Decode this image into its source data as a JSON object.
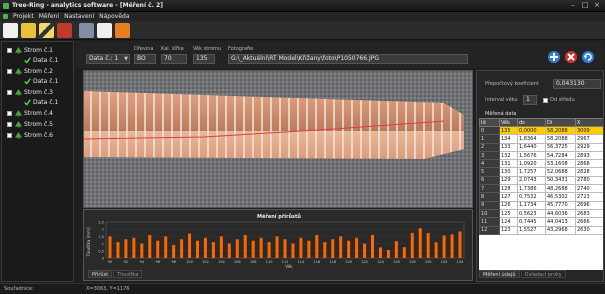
{
  "window": {
    "title": "Tree-Ring - analytics software - [Měření č. 2]"
  },
  "menu": {
    "items": [
      "Projekt",
      "Měření",
      "Nastavení",
      "Nápověda"
    ]
  },
  "tree": {
    "items": [
      {
        "label": "Strom č.1",
        "level": 0
      },
      {
        "label": "Data č.1",
        "level": 1
      },
      {
        "label": "Strom č.2",
        "level": 0
      },
      {
        "label": "Data č.1",
        "level": 1
      },
      {
        "label": "Strom č.3",
        "level": 0
      },
      {
        "label": "Data č.1",
        "level": 1
      },
      {
        "label": "Strom č.4",
        "level": 0
      },
      {
        "label": "Strom č.5",
        "level": 0
      },
      {
        "label": "Strom č.6",
        "level": 0
      }
    ]
  },
  "params": {
    "data_select": "Data č.: 1",
    "drevina_label": "Dřevina",
    "drevina_value": "BO",
    "kal_label": "Kal. šířka",
    "kal_value": "70",
    "vek_label": "Věk stromu",
    "vek_value": "135",
    "foto_label": "Fotografie",
    "foto_path": "G:\\_Aktuální\\RT Model\\Křižany\\foto\\P1050766.JPG"
  },
  "right": {
    "coef_label": "Přepočtový koeficient",
    "coef_value": "0,043130",
    "interval_label": "Interval věku",
    "interval_value": "1",
    "from_center_label": "Od středu",
    "section_title": "Měřená data",
    "columns": [
      "Id",
      "Věk",
      "ds",
      "Di",
      "X"
    ],
    "rows": [
      [
        "0",
        "135",
        "0,0000",
        "58,2088",
        "3009"
      ],
      [
        "1",
        "134",
        "1,8364",
        "58,2088",
        "2967"
      ],
      [
        "2",
        "133",
        "1,6440",
        "56,3725",
        "2929"
      ],
      [
        "3",
        "132",
        "1,5676",
        "54,7284",
        "2893"
      ],
      [
        "4",
        "131",
        "1,0920",
        "53,1608",
        "2868"
      ],
      [
        "5",
        "130",
        "1,7257",
        "52,0688",
        "2828"
      ],
      [
        "6",
        "129",
        "2,0743",
        "50,3431",
        "2780"
      ],
      [
        "7",
        "128",
        "1,7386",
        "48,2688",
        "2740"
      ],
      [
        "8",
        "127",
        "0,7532",
        "46,5302",
        "2723"
      ],
      [
        "9",
        "126",
        "1,1734",
        "45,7770",
        "2696"
      ],
      [
        "10",
        "125",
        "0,5623",
        "44,6036",
        "2683"
      ],
      [
        "11",
        "124",
        "0,7445",
        "44,0413",
        "2666"
      ],
      [
        "12",
        "123",
        "1,5527",
        "43,2968",
        "2630"
      ]
    ]
  },
  "chart_tabs": [
    "Přírůst",
    "Tloušťka"
  ],
  "right_tabs": [
    "Měření údajů",
    "Ovládací prvky"
  ],
  "status": {
    "left": "Souřadnice:",
    "coords": "X=3063, Y=1176"
  },
  "chart_data": {
    "type": "bar",
    "title": "Měření přírůstů",
    "xlabel": "Věk",
    "ylabel": "Tloušťka [mm]",
    "ylim": [
      0,
      2.5
    ],
    "x_ticks": [
      "90",
      "92",
      "94",
      "96",
      "98",
      "100",
      "102",
      "104",
      "106",
      "108",
      "110",
      "112",
      "114",
      "116",
      "118",
      "120",
      "122",
      "124",
      "126",
      "128",
      "130",
      "132",
      "134"
    ],
    "y_ticks": [
      "0",
      "0,5",
      "1",
      "1,5",
      "2",
      "2,5"
    ],
    "x": [
      90,
      91,
      92,
      93,
      94,
      95,
      96,
      97,
      98,
      99,
      100,
      101,
      102,
      103,
      104,
      105,
      106,
      107,
      108,
      109,
      110,
      111,
      112,
      113,
      114,
      115,
      116,
      117,
      118,
      119,
      120,
      121,
      122,
      123,
      124,
      125,
      126,
      127,
      128,
      129,
      130,
      131,
      132,
      133,
      134
    ],
    "values": [
      1.5,
      1.1,
      1.3,
      1.4,
      1.0,
      1.6,
      1.2,
      1.5,
      0.9,
      1.3,
      1.7,
      1.2,
      1.4,
      1.1,
      1.5,
      1.0,
      1.3,
      1.6,
      1.2,
      1.4,
      1.1,
      1.5,
      1.3,
      1.0,
      1.4,
      1.2,
      1.6,
      1.1,
      1.3,
      1.5,
      1.2,
      1.4,
      1.0,
      1.6,
      0.74,
      0.56,
      1.17,
      0.75,
      1.74,
      2.07,
      1.73,
      1.09,
      1.57,
      1.64,
      1.84
    ],
    "bar_color": "#ff6600"
  },
  "colors": {
    "selected_row": "#ffcc00",
    "bar": "#ff6600",
    "accent_green": "#4caf50"
  }
}
